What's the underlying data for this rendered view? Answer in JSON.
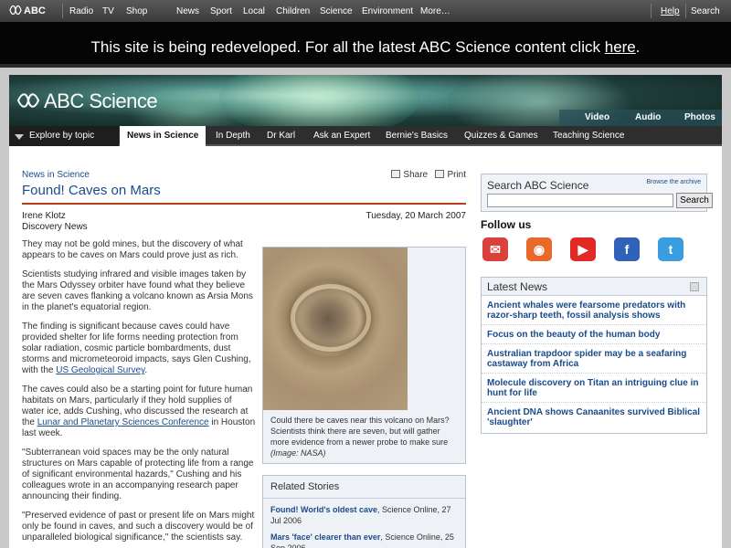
{
  "topbar": {
    "logo": "ABC",
    "left_links": [
      "Radio",
      "TV",
      "Shop"
    ],
    "center_links": [
      "News",
      "Sport",
      "Local",
      "Children",
      "Science",
      "Environment",
      "More…"
    ],
    "right_links": [
      "Help",
      "Search"
    ]
  },
  "banner": {
    "text": "This site is being redeveloped. For all the latest ABC Science content click",
    "link": "here",
    "suffix": "."
  },
  "header": {
    "brand": "ABC Science",
    "media_links": [
      "Video",
      "Audio",
      "Photos"
    ]
  },
  "nav": {
    "explore": "Explore by topic",
    "tabs": [
      "News in Science",
      "In Depth",
      "Dr Karl",
      "Ask an Expert",
      "Bernie's Basics",
      "Quizzes & Games",
      "Teaching Science"
    ],
    "active_tab": "News in Science"
  },
  "article": {
    "section": "News in Science",
    "share": "Share",
    "print": "Print",
    "headline": "Found! Caves on Mars",
    "author": "Irene Klotz",
    "source": "Discovery News",
    "date": "Tuesday, 20 March 2007",
    "p1": "They may not be gold mines, but the discovery of what appears to be caves on Mars could prove just as rich.",
    "p2": "Scientists studying infrared and visible images taken by the Mars Odyssey orbiter have found what they believe are seven caves flanking a volcano known as Arsia Mons in the planet's equatorial region.",
    "p3": "The finding is significant because caves could have provided shelter for life forms needing protection from solar radiation, cosmic particle bombardments, dust storms and micrometeoroid impacts, says Glen Cushing, with the",
    "p3_link": "US Geological Survey",
    "p3_end": ".",
    "p4": "The caves could also be a starting point for future human habitats on Mars, particularly if they hold supplies of water ice, adds Cushing, who discussed the research at the",
    "p4_link": "Lunar and Planetary Sciences Conference",
    "p4_end": "in Houston last week.",
    "p5": "\"Subterranean void spaces may be the only natural structures on Mars capable of protecting life from a range of significant environmental hazards,\" Cushing and his colleagues wrote in an accompanying research paper announcing their finding.",
    "p6": "\"Preserved evidence of past or present life on Mars might only be found in caves, and such a discovery would be of unparalleled biological significance,\" the scientists say.",
    "figure_caption": "Could there be caves near this volcano on Mars? Scientists think there are seven, but will gather more evidence from a newer probe to make sure",
    "figure_credit": "(Image: NASA)"
  },
  "related": {
    "title": "Related Stories",
    "items": [
      {
        "title": "Found! World's oldest cave",
        "meta": ", Science Online, 27 Jul 2006"
      },
      {
        "title": "Mars 'face' clearer than ever",
        "meta": ", Science Online, 25 Sep 2006"
      }
    ]
  },
  "search": {
    "title": "Search ABC Science",
    "browse": "Browse the archive",
    "placeholder": "",
    "button": "Search"
  },
  "follow": {
    "title": "Follow us",
    "icons": [
      "email-icon",
      "podcast-icon",
      "youtube-icon",
      "facebook-icon",
      "twitter-icon"
    ]
  },
  "latest": {
    "title": "Latest News",
    "items": [
      "Ancient whales were fearsome predators with razor-sharp teeth, fossil analysis shows",
      "Focus on the beauty of the human body",
      "Australian trapdoor spider may be a seafaring castaway from Africa",
      "Molecule discovery on Titan an intriguing clue in hunt for life",
      "Ancient DNA shows Canaanites survived Biblical 'slaughter'"
    ]
  },
  "colors": {
    "link": "#1a4b8c",
    "rule": "#b4401a",
    "banner_bg": "#050505"
  }
}
